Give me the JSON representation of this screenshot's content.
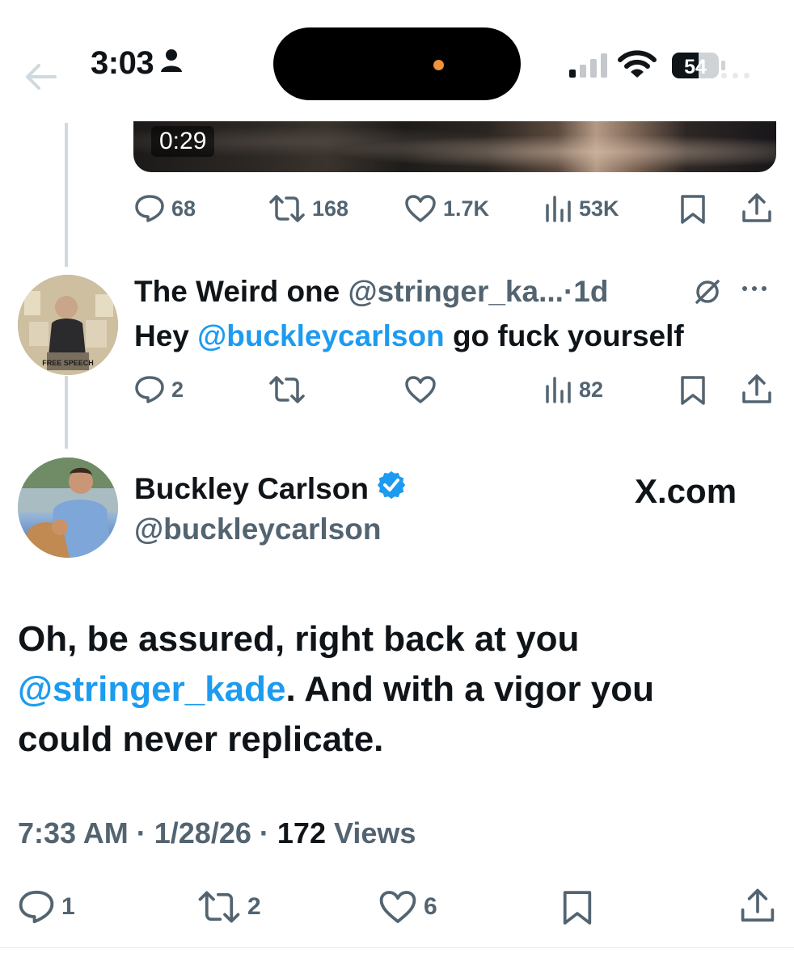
{
  "status_bar": {
    "time": "3:03",
    "battery": "54"
  },
  "video": {
    "duration": "0:29"
  },
  "parent_tweet": {
    "replies": "68",
    "retweets": "168",
    "likes": "1.7K",
    "views": "53K"
  },
  "reply_tweet": {
    "display_name": "The Weird one",
    "handle": "@stringer_ka...",
    "separator": "·",
    "age": "1d",
    "text_before": "Hey",
    "mention": "@buckleycarlson",
    "text_after": "go fuck yourself",
    "replies": "2",
    "views": "82",
    "avatar_text": "FREE SPEECH"
  },
  "main_tweet": {
    "display_name": "Buckley Carlson",
    "handle": "@buckleycarlson",
    "watermark": "X.com",
    "text_line1": "Oh, be assured, right back at you",
    "mention": "@stringer_kade",
    "text_line2_rest": ". And with a vigor you",
    "text_line3": "could never replicate.",
    "time": "7:33 AM",
    "date": "1/28/26",
    "views_count": "172",
    "views_label": "Views",
    "replies": "1",
    "retweets": "2",
    "likes": "6"
  },
  "colors": {
    "accent": "#1d9bf0",
    "text": "#0f1419",
    "muted": "#536471"
  }
}
